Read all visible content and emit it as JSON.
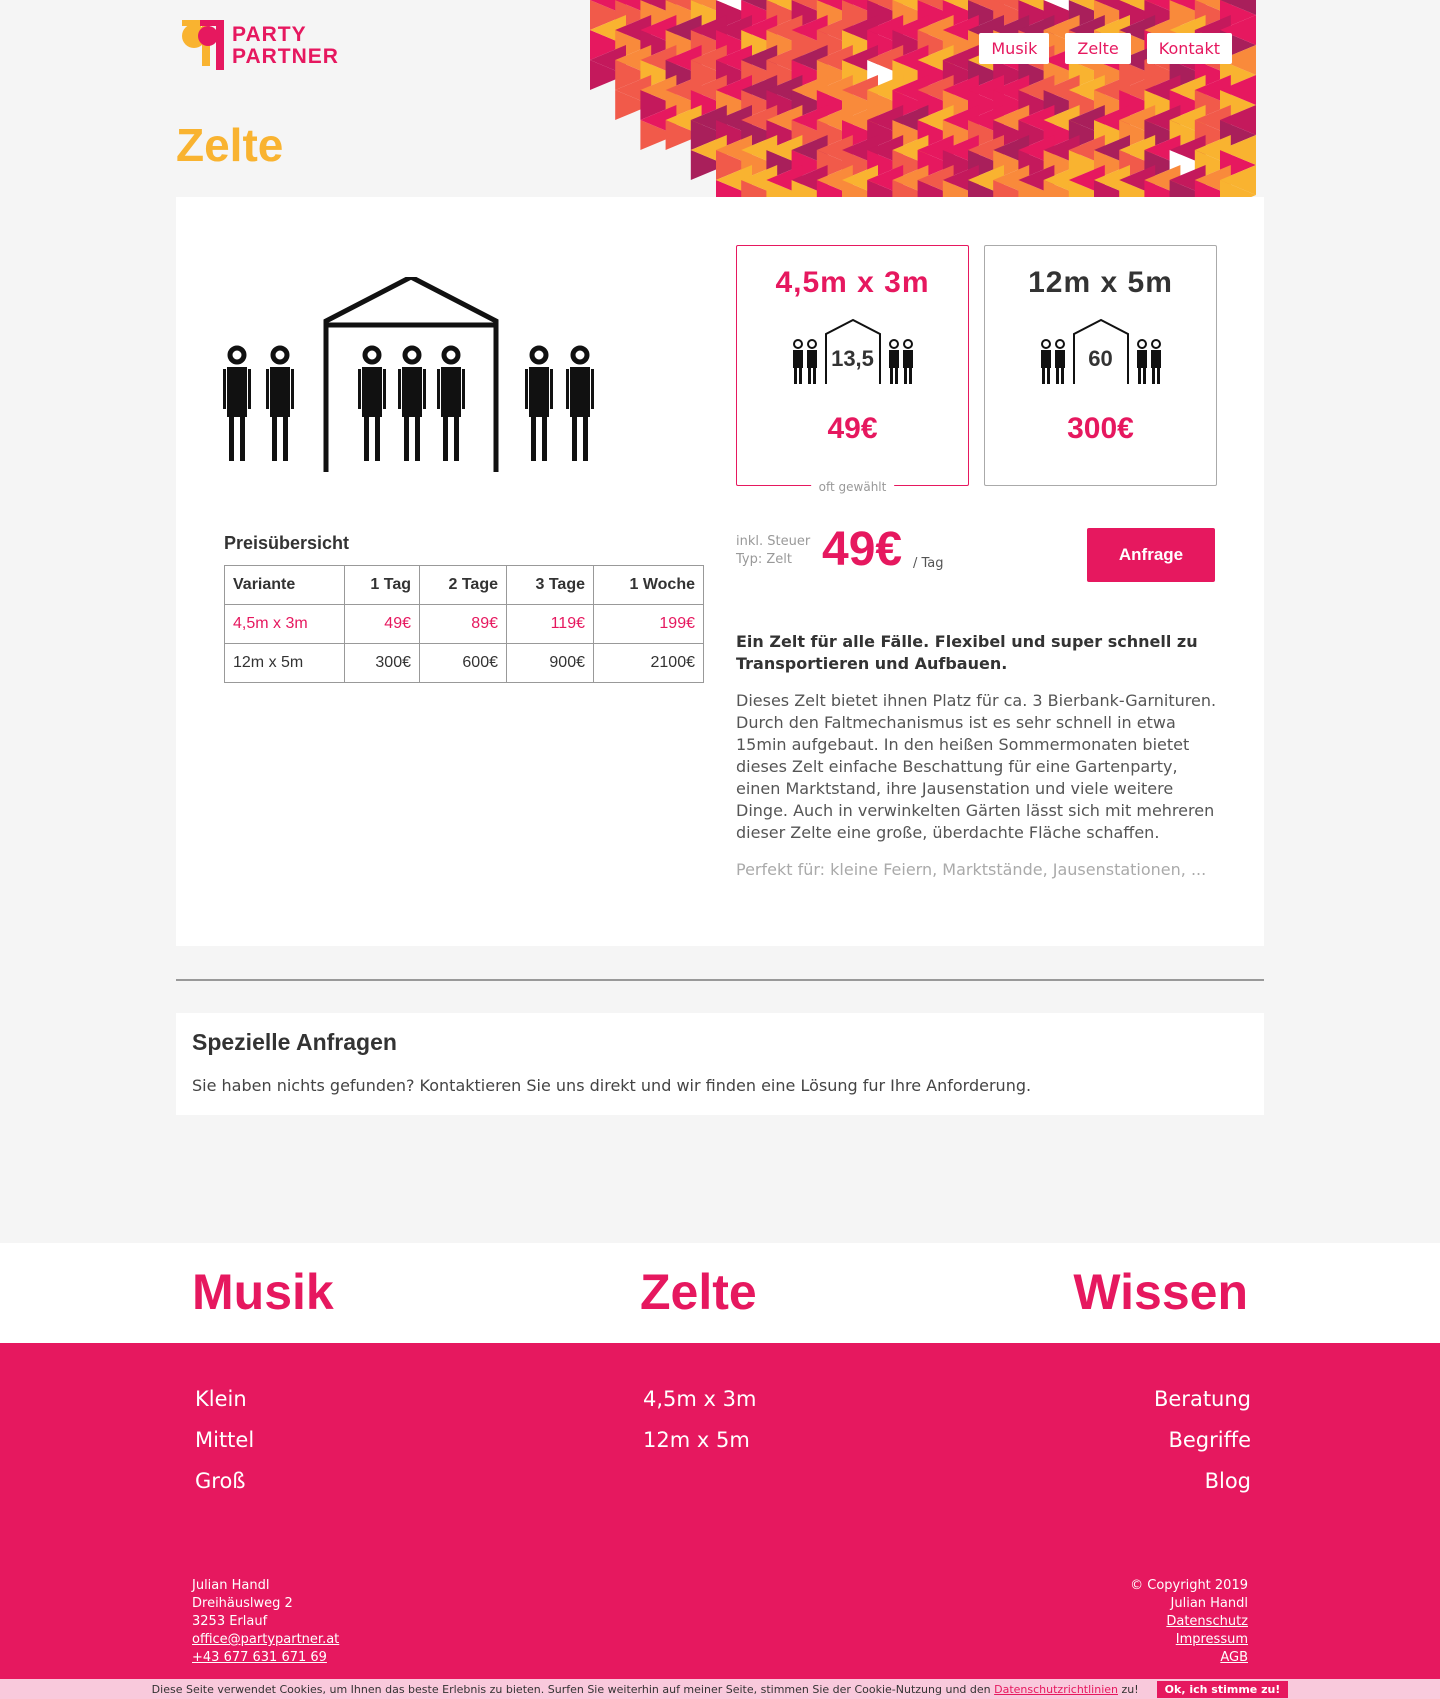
{
  "colors": {
    "accent": "#e6185f",
    "title": "#f9b330",
    "pattern": [
      "#e6185f",
      "#c4195c",
      "#f15a4a",
      "#f98a3b",
      "#f9b330",
      "#a91f5b",
      "#ffffff"
    ]
  },
  "logo": {
    "line1": "PARTY",
    "line2": "PARTNER"
  },
  "nav": {
    "items": [
      "Musik",
      "Zelte",
      "Kontakt"
    ]
  },
  "page": {
    "title": "Zelte"
  },
  "prices": {
    "heading": "Preisübersicht",
    "columns": [
      "Variante",
      "1 Tag",
      "2 Tage",
      "3 Tage",
      "1 Woche"
    ],
    "rows": [
      [
        "4,5m x 3m",
        "49€",
        "89€",
        "119€",
        "199€"
      ],
      [
        "12m x 5m",
        "300€",
        "600€",
        "900€",
        "2100€"
      ]
    ]
  },
  "options": [
    {
      "title": "4,5m x 3m",
      "capacity": "13,5",
      "price": "49€",
      "note": "oft gewählt"
    },
    {
      "title": "12m x 5m",
      "capacity": "60",
      "price": "300€"
    }
  ],
  "summary": {
    "meta_line1": "inkl. Steuer",
    "meta_line2": "Typ: Zelt",
    "price": "49€",
    "per": "/ Tag",
    "button": "Anfrage"
  },
  "description": {
    "lead": "Ein Zelt für alle Fälle. Flexibel und super schnell zu Transportieren und Aufbauen.",
    "body": "Dieses Zelt bietet ihnen Platz für ca. 3 Bierbank-Garnituren. Durch den Faltmechanismus ist es sehr schnell in etwa 15min aufgebaut. In den heißen Sommermonaten bietet dieses Zelt einfache Beschattung für eine Gartenparty, einen Marktstand, ihre Jausenstation und viele weitere Dinge. Auch in verwinkelten Gärten lässt sich mit mehreren dieser Zelte eine große, überdachte Fläche schaffen.",
    "perfect": "Perfekt für: kleine Feiern, Marktstände, Jausenstationen, ..."
  },
  "special": {
    "title": "Spezielle Anfragen",
    "text": "Sie haben nichts gefunden? Kontaktieren Sie uns direkt und wir finden eine Lösung fur Ihre Anforderung."
  },
  "footer": {
    "heads": [
      "Musik",
      "Zelte",
      "Wissen"
    ],
    "musik": [
      "Klein",
      "Mittel",
      "Groß"
    ],
    "zelte": [
      "4,5m x 3m",
      "12m x 5m"
    ],
    "wissen": [
      "Beratung",
      "Begriffe",
      "Blog"
    ],
    "address": {
      "name": "Julian Handl",
      "street": "Dreihäuslweg 2",
      "city": "3253 Erlauf",
      "email": "office@partypartner.at",
      "phone": "+43 677 631 671 69"
    },
    "legal": {
      "copyright": "© Copyright 2019",
      "name": "Julian Handl",
      "links": [
        "Datenschutz",
        "Impressum",
        "AGB"
      ]
    }
  },
  "cookie": {
    "text": "Diese Seite verwendet Cookies, um Ihnen das beste Erlebnis zu bieten. Surfen Sie weiterhin auf meiner Seite, stimmen Sie der Cookie-Nutzung und den",
    "link": "Datenschutzrichtlinien",
    "suffix": "zu!",
    "button": "Ok, ich stimme zu!"
  }
}
